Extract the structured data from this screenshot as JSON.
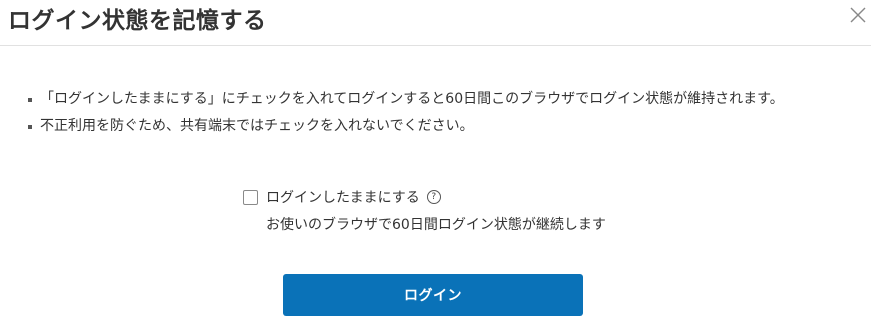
{
  "dialog": {
    "title": "ログイン状態を記憶する",
    "close_icon": "close-icon"
  },
  "notes": [
    "「ログインしたままにする」にチェックを入れてログインすると60日間このブラウザでログイン状態が維持されます。",
    "不正利用を防ぐため、共有端末ではチェックを入れないでください。"
  ],
  "remember": {
    "label": "ログインしたままにする",
    "checked": false,
    "help_icon": "question-circle-icon",
    "help_glyph": "?",
    "description": "お使いのブラウザで60日間ログイン状態が継続します"
  },
  "login_button": {
    "label": "ログイン"
  },
  "colors": {
    "primary": "#0a72b8",
    "text": "#333333",
    "divider": "#e1e1e1"
  }
}
